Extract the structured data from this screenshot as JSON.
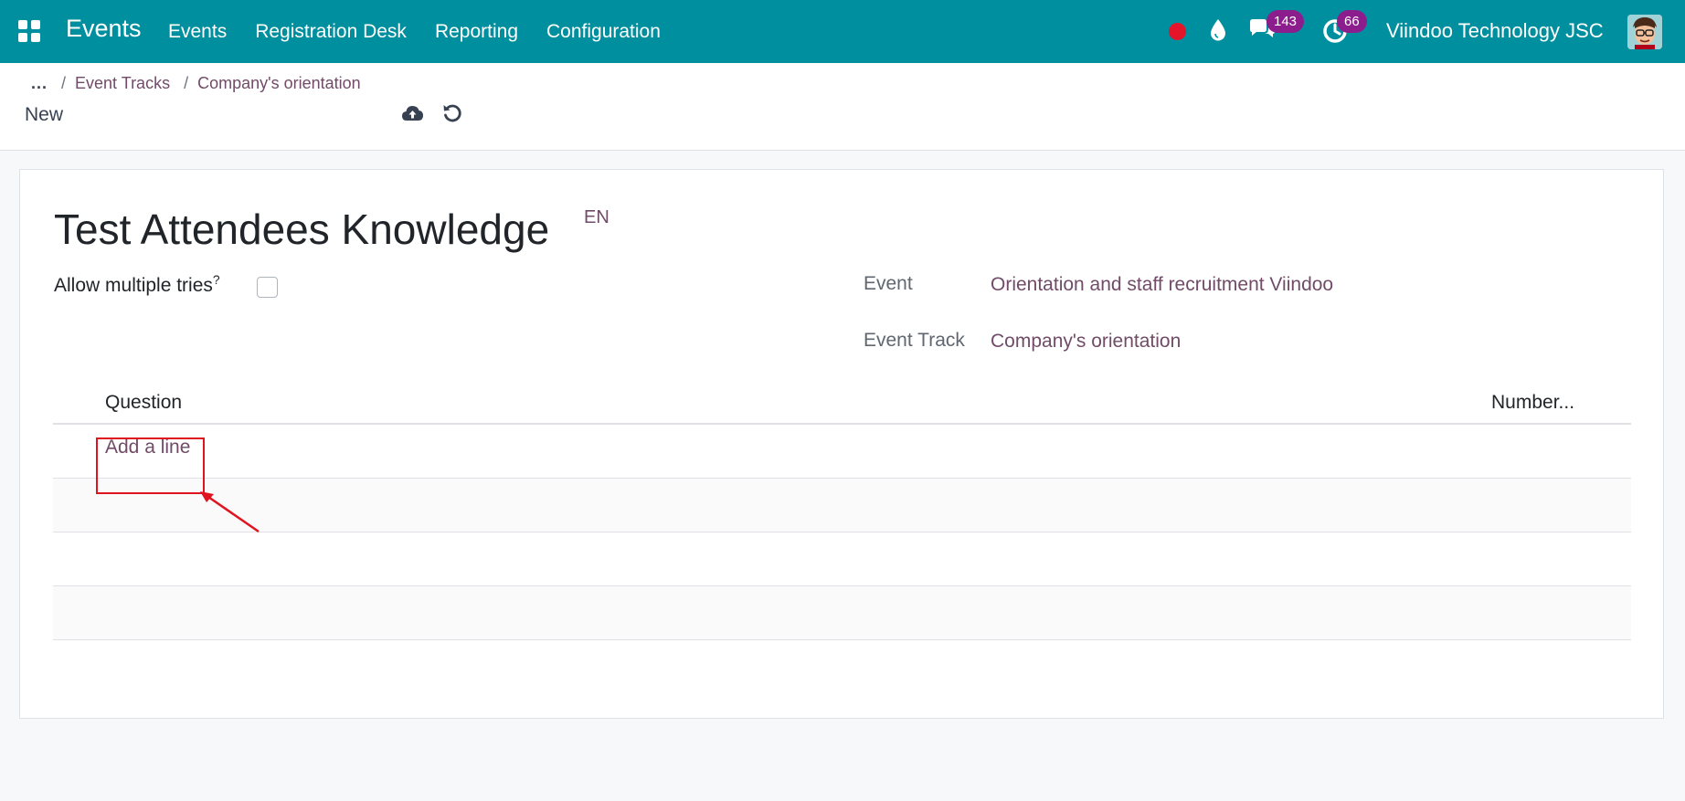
{
  "navbar": {
    "app_title": "Events",
    "menu": [
      "Events",
      "Registration Desk",
      "Reporting",
      "Configuration"
    ],
    "messages_count": "143",
    "activities_count": "66",
    "company": "Viindoo Technology JSC",
    "recording_color": "#e4142b",
    "bg_color": "#008f9e"
  },
  "breadcrumb": {
    "more": "...",
    "items": [
      "Event Tracks",
      "Company's orientation"
    ]
  },
  "record_status": "New",
  "form": {
    "title": "Test Attendees Knowledge",
    "lang": "EN",
    "allow_multiple_tries_label": "Allow multiple tries",
    "allow_multiple_tries_help": "?",
    "allow_multiple_tries_checked": false,
    "event_label": "Event",
    "event_value": "Orientation and staff recruitment Viindoo",
    "event_track_label": "Event Track",
    "event_track_value": "Company's orientation"
  },
  "table": {
    "columns": [
      "Question",
      "Number..."
    ],
    "add_line": "Add a line"
  },
  "icons": [
    "apps-icon",
    "drop-icon",
    "chat-icon",
    "clock-icon",
    "avatar",
    "save-icon",
    "discard-icon"
  ]
}
